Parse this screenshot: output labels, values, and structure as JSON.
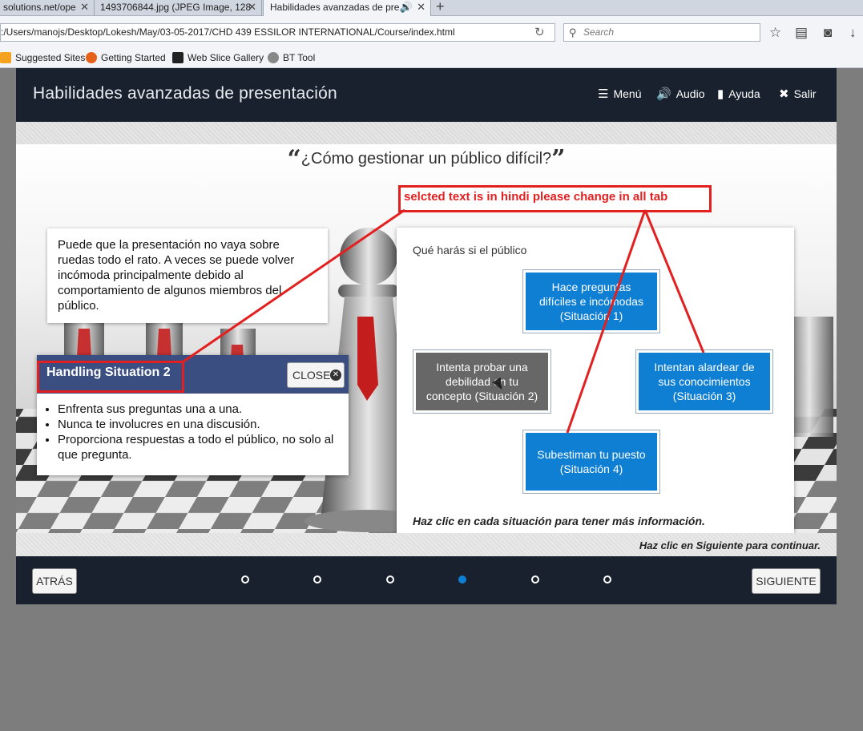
{
  "browser": {
    "tabs": [
      {
        "title": "solutions.net/ope",
        "active": false
      },
      {
        "title": "1493706844.jpg (JPEG Image, 128",
        "active": false
      },
      {
        "title": "Habilidades avanzadas de pre",
        "active": true
      }
    ],
    "url": ":/Users/manojs/Desktop/Lokesh/May/03-05-2017/CHD 439 ESSILOR INTERNATIONAL/Course/index.html",
    "search_placeholder": "Search",
    "bookmarks": [
      "Suggested Sites",
      "Getting Started",
      "Web Slice Gallery",
      "BT Tool"
    ]
  },
  "course": {
    "title": "Habilidades avanzadas de presentación",
    "menu": [
      "Menú",
      "Audio",
      "Ayuda",
      "Salir"
    ],
    "question": "¿Cómo gestionar un público difícil?",
    "intro_text": "Puede que la presentación no vaya sobre ruedas todo el rato. A veces se puede volver incómoda principalmente debido al comportamiento de algunos miembros del público.",
    "popup": {
      "title": "Handling Situation 2",
      "close_label": "CLOSE",
      "bullets": [
        "Enfrenta sus preguntas una a una.",
        "Nunca te involucres en una discusión.",
        "Proporciona respuestas a todo el público, no solo al que pregunta."
      ]
    },
    "panel": {
      "intro": "Qué harás si el público",
      "situations": [
        "Hace preguntas difíciles e incómodas (Situación 1)",
        "Intenta probar una debilidad en tu concepto (Situación 2)",
        "Intentan alardear de sus conocimientos (Situación 3)",
        "Subestiman tu puesto (Situación 4)"
      ],
      "footer": "Haz clic en cada situación para tener más información."
    },
    "continue_note": "Haz clic en Siguiente para continuar.",
    "back_label": "ATRÁS",
    "next_label": "SIGUIENTE",
    "page_dots": 6,
    "current_page": 4
  },
  "annotation": {
    "text": "selcted text is in hindi please change in all tab",
    "color": "#e32020"
  },
  "colors": {
    "header_bg": "#18212d",
    "situation_blue": "#0e7fd3",
    "situation_active": "#676767",
    "popup_header": "#3b4e82"
  }
}
